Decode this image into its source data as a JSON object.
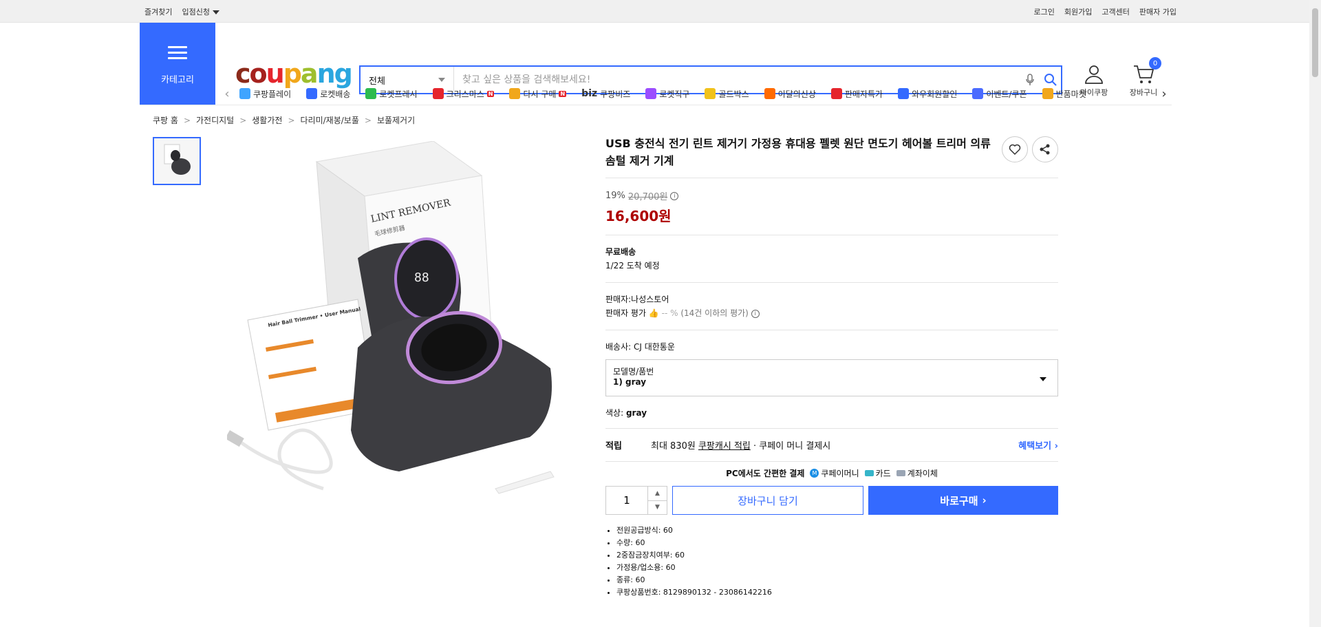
{
  "topbar": {
    "favorites": "즐겨찾기",
    "partner": "입점신청",
    "login": "로그인",
    "signup": "회원가입",
    "support": "고객센터",
    "seller_signup": "판매자 가입"
  },
  "header": {
    "category_label": "카테고리",
    "logo_letters": [
      "c",
      "o",
      "u",
      "p",
      "a",
      "n",
      "g"
    ],
    "search_scope": "전체",
    "search_placeholder": "찾고 싶은 상품을 검색해보세요!",
    "mypage": "마이쿠팡",
    "cart": "장바구니",
    "cart_count": "0"
  },
  "categories": [
    {
      "label": "쿠팡플레이",
      "color": "#3fa4ff"
    },
    {
      "label": "로켓배송",
      "color": "#346aff"
    },
    {
      "label": "로켓프레시",
      "color": "#2dbb4f"
    },
    {
      "label": "크리스마스",
      "color": "#e5252d",
      "new": "N"
    },
    {
      "label": "다시 구매",
      "color": "#f1a71b",
      "new": "N"
    },
    {
      "label": "쿠팡비즈",
      "color": "#1a1a1a",
      "prefix": "biz"
    },
    {
      "label": "로켓직구",
      "color": "#9b4dff"
    },
    {
      "label": "골드박스",
      "color": "#f1c21b"
    },
    {
      "label": "이달의신상",
      "color": "#ff6a00"
    },
    {
      "label": "판매자특가",
      "color": "#e5252d"
    },
    {
      "label": "와우회원할인",
      "color": "#346aff"
    },
    {
      "label": "이벤트/쿠폰",
      "color": "#4b6bff"
    },
    {
      "label": "반품마켓",
      "color": "#f1a71b"
    }
  ],
  "breadcrumb": [
    "쿠팡 홈",
    "가전디지털",
    "생활가전",
    "다리미/재봉/보풀",
    "보풀제거기"
  ],
  "product": {
    "title": "USB 충전식 전기 린트 제거기 가정용 휴대용 펠렛 원단 면도기 헤어볼 트리머 의류 솜털 제거 기계",
    "discount": "19%",
    "original_price": "20,700원",
    "price": "16,600원",
    "shipping_title": "무료배송",
    "arrival": "1/22 도착 예정",
    "seller": "판매자:나성스토어",
    "seller_rating_label": "판매자 평가",
    "seller_rating_value": "-- %",
    "seller_rating_note": "(14건 이하의 평가)",
    "courier": "배송사:  CJ 대한통운",
    "option_label": "모델명/품번",
    "option_value": "1) gray",
    "color_label": "색상:",
    "color_value": "gray",
    "reward_title": "적립",
    "reward_text": "최대 830원",
    "reward_link": "쿠팡캐시 적립",
    "reward_tail": "· 쿠페이 머니 결제시",
    "reward_more": "혜택보기",
    "pay_label": "PC에서도 간편한 결제",
    "pay_methods": [
      "쿠페이머니",
      "카드",
      "계좌이체"
    ],
    "qty": "1",
    "cart_btn": "장바구니 담기",
    "buy_btn": "바로구매",
    "specs": [
      "전원공급방식: 60",
      "수량: 60",
      "2중잠금장치여부: 60",
      "가정용/업소용: 60",
      "종류: 60",
      "쿠팡상품번호: 8129890132 - 23086142216"
    ]
  },
  "image_text": {
    "box_brand": "LINT REMOVER",
    "box_brand_cn": "毛球修剪器",
    "manual_title": "Hair Ball Trimmer • User Manual",
    "display": "88"
  }
}
